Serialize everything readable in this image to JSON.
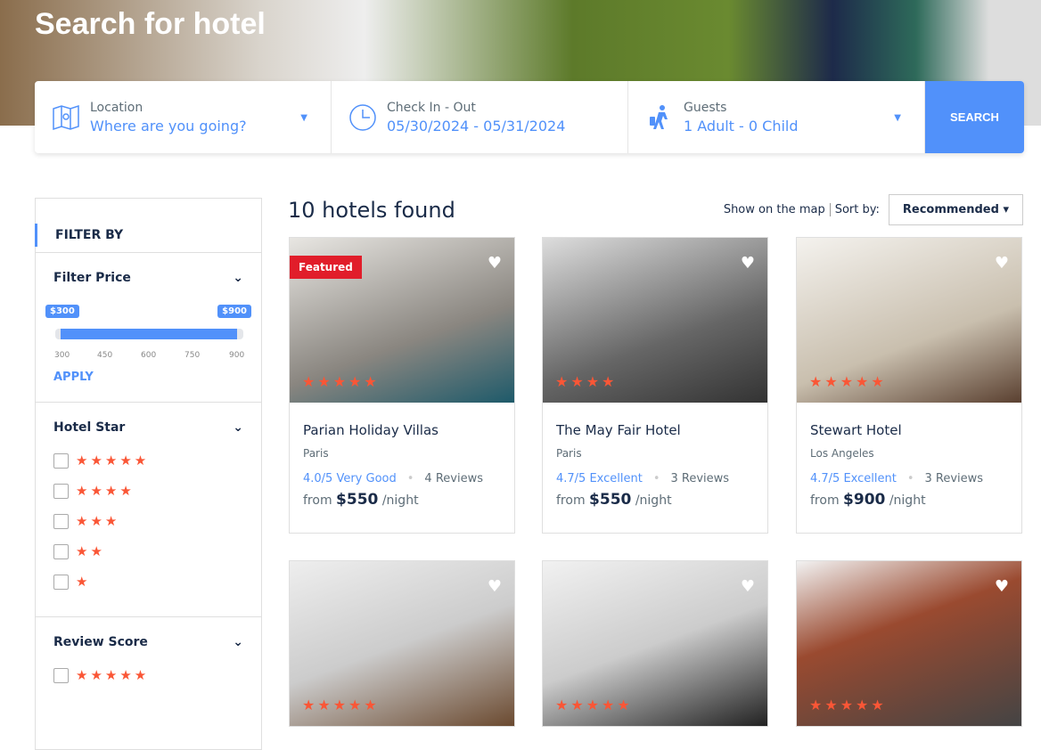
{
  "hero": {
    "title": "Search for hotel"
  },
  "search": {
    "location_label": "Location",
    "location_value": "Where are you going?",
    "dates_label": "Check In - Out",
    "dates_value": "05/30/2024 - 05/31/2024",
    "guests_label": "Guests",
    "guests_value": "1 Adult - 0 Child",
    "button": "SEARCH"
  },
  "filter": {
    "title": "FILTER BY",
    "price": {
      "title": "Filter Price",
      "min_tag": "$300",
      "max_tag": "$900",
      "ticks": [
        "300",
        "450",
        "600",
        "750",
        "900"
      ],
      "apply": "APPLY"
    },
    "hotel_star": {
      "title": "Hotel Star",
      "options": [
        "★★★★★",
        "★★★★",
        "★★★",
        "★★",
        "★"
      ]
    },
    "review_score": {
      "title": "Review Score",
      "options": [
        "★★★★★"
      ]
    }
  },
  "results": {
    "count_text": "10 hotels found",
    "show_map": "Show on the map",
    "sort_label": "Sort by:",
    "sort_value": "Recommended"
  },
  "hotels": [
    {
      "name": "Parian Holiday Villas",
      "city": "Paris",
      "score": "4.0/5 Very Good",
      "reviews": "4 Reviews",
      "from": "from",
      "price": "$550",
      "unit": "/night",
      "stars": "★★★★★",
      "badge": "Featured"
    },
    {
      "name": "The May Fair Hotel",
      "city": "Paris",
      "score": "4.7/5 Excellent",
      "reviews": "3 Reviews",
      "from": "from",
      "price": "$550",
      "unit": "/night",
      "stars": "★★★★"
    },
    {
      "name": "Stewart Hotel",
      "city": "Los Angeles",
      "score": "4.7/5 Excellent",
      "reviews": "3 Reviews",
      "from": "from",
      "price": "$900",
      "unit": "/night",
      "stars": "★★★★★"
    },
    {
      "stars": "★★★★★"
    },
    {
      "stars": "★★★★★"
    },
    {
      "stars": "★★★★★"
    }
  ]
}
